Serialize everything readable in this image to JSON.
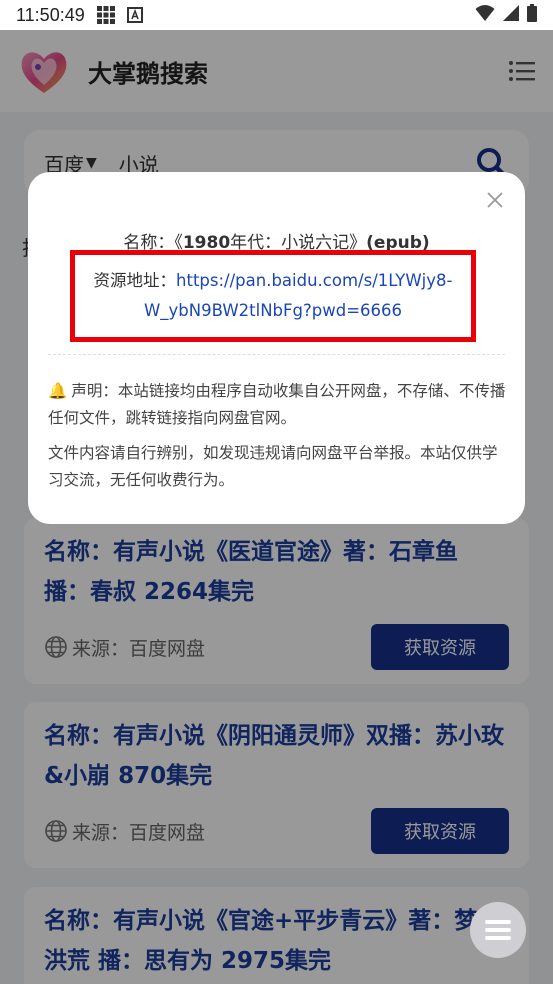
{
  "status_bar": {
    "time": "11:50:49"
  },
  "header": {
    "site_title": "大掌鹅搜索"
  },
  "search": {
    "engine": "百度",
    "query": "小说"
  },
  "background_text": "找",
  "results": [
    {
      "title": "名称：有声小说《医道官途》著：石章鱼 播：春叔 2264集完",
      "source": "来源：百度网盘",
      "button": "获取资源"
    },
    {
      "title": "名称：有声小说《阴阳通灵师》双播：苏小玫&小崩 870集完",
      "source": "来源：百度网盘",
      "button": "获取资源"
    },
    {
      "title": "名称：有声小说《官途+平步青云》著：梦入洪荒 播：思有为 2975集完"
    }
  ],
  "modal": {
    "name_prefix": "名称：《",
    "name_bold": "1980",
    "name_middle": "年代：小说六记》",
    "name_suffix": "(epub)",
    "link_label": "资源地址：",
    "link_url_part1": "https://pan.baidu.com/s/1LYWjy8-",
    "link_url_part2": "W_ybN9BW2tlNbFg?pwd=6666",
    "notice_1": "声明：本站链接均由程序自动收集自公开网盘，不存储、不传播任何文件，跳转链接指向网盘官网。",
    "notice_2": "文件内容请自行辨别，如发现违规请向网盘平台举报。本站仅供学习交流，无任何收费行为。"
  },
  "colors": {
    "accent_blue": "#16308a",
    "title_blue": "#1c3e9c",
    "highlight_red": "#e8000b"
  }
}
